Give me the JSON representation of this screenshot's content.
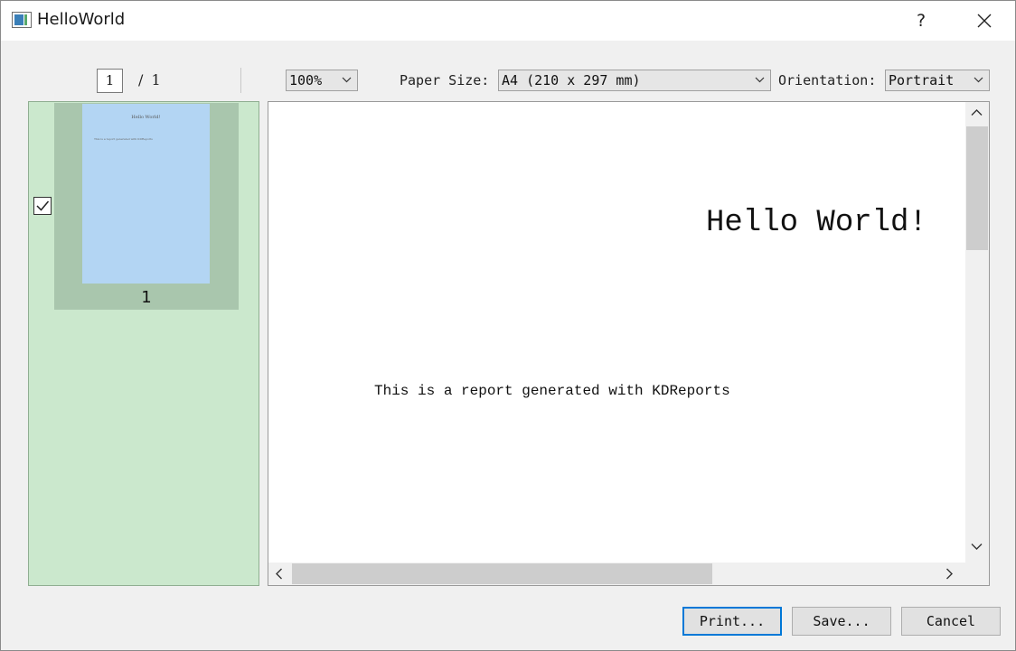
{
  "window": {
    "title": "HelloWorld",
    "help_label": "?"
  },
  "toolbar": {
    "current_page": "1",
    "page_total": "/ 1",
    "zoom": "100%",
    "paper_size_label": "Paper Size:",
    "paper_size_value": "A4 (210 x 297 mm)",
    "orientation_label": "Orientation:",
    "orientation_value": "Portrait"
  },
  "thumbnails": {
    "items": [
      {
        "page_number": "1",
        "checked": true,
        "title": "Hello World!",
        "text": "This is a report generated with KDReports"
      }
    ]
  },
  "preview": {
    "title": "Hello World!",
    "body": "This is a report generated with KDReports"
  },
  "buttons": {
    "print": "Print...",
    "save": "Save...",
    "cancel": "Cancel"
  },
  "colors": {
    "thumbnail_panel_bg": "#cbe8cd",
    "thumbnail_frame": "#a9c6ad",
    "thumbnail_page": "#b3d5f3",
    "default_button_border": "#0078d7"
  }
}
